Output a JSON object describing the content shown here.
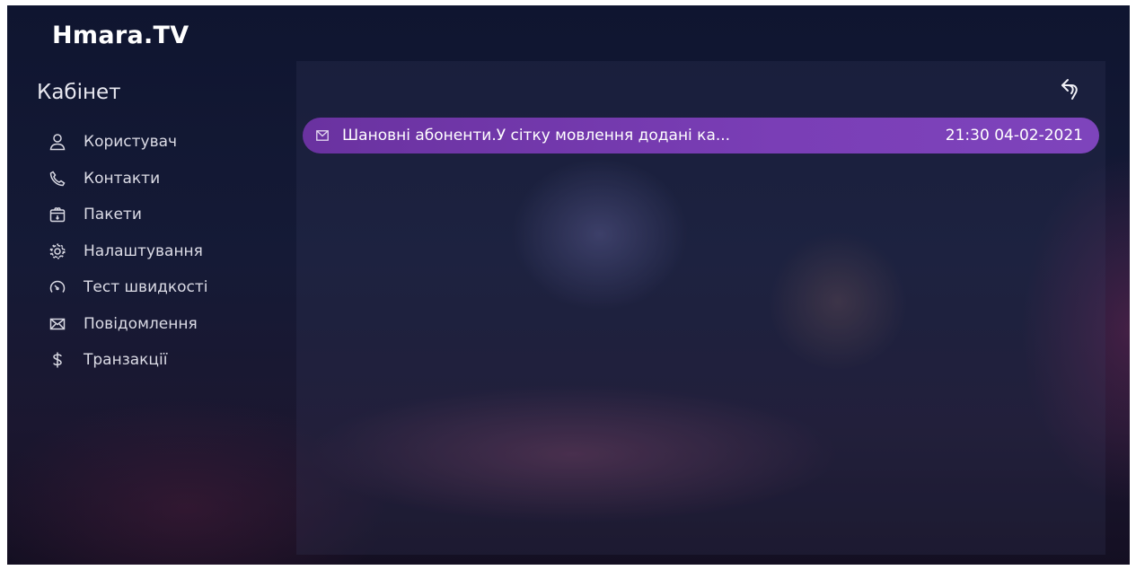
{
  "app": {
    "logo": "Hmara.TV"
  },
  "sidebar": {
    "title": "Кабінет",
    "items": [
      {
        "label": "Користувач",
        "icon": "user-icon"
      },
      {
        "label": "Контакти",
        "icon": "phone-icon"
      },
      {
        "label": "Пакети",
        "icon": "package-icon"
      },
      {
        "label": "Налаштування",
        "icon": "gear-icon"
      },
      {
        "label": "Тест швидкості",
        "icon": "speedometer-icon"
      },
      {
        "label": "Повідомлення",
        "icon": "envelope-icon"
      },
      {
        "label": "Транзакції",
        "icon": "dollar-icon"
      }
    ]
  },
  "main": {
    "back_icon": "back-arrow-icon",
    "messages": [
      {
        "icon": "envelope-icon",
        "text": "Шановні абоненти.У сітку мовлення додані ка...",
        "date": "21:30 04-02-2021",
        "selected": true
      }
    ]
  },
  "colors": {
    "accent": "#7a3eb6",
    "background": "#151a36",
    "text": "#ffffff"
  }
}
